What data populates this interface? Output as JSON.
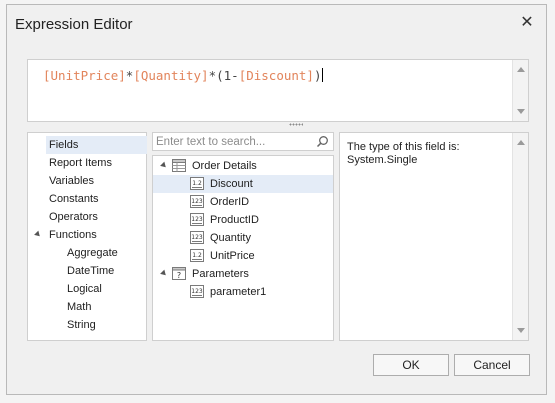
{
  "dialog": {
    "title": "Expression Editor"
  },
  "expression": {
    "tokens": [
      {
        "type": "field",
        "text": "[UnitPrice]"
      },
      {
        "type": "op",
        "text": "*"
      },
      {
        "type": "field",
        "text": "[Quantity]"
      },
      {
        "type": "op",
        "text": "*(1-"
      },
      {
        "type": "field",
        "text": "[Discount]"
      },
      {
        "type": "op",
        "text": ")"
      }
    ]
  },
  "categories": {
    "items": [
      "Fields",
      "Report Items",
      "Variables",
      "Constants",
      "Operators",
      "Functions"
    ],
    "functions": [
      "Aggregate",
      "DateTime",
      "Logical",
      "Math",
      "String"
    ],
    "selected": "Fields"
  },
  "search": {
    "placeholder": "Enter text to search..."
  },
  "tree": {
    "order_details": {
      "label": "Order Details",
      "fields": [
        {
          "label": "Discount",
          "type": "1.2"
        },
        {
          "label": "OrderID",
          "type": "123"
        },
        {
          "label": "ProductID",
          "type": "123"
        },
        {
          "label": "Quantity",
          "type": "123"
        },
        {
          "label": "UnitPrice",
          "type": "1.2"
        }
      ]
    },
    "parameters": {
      "label": "Parameters",
      "items": [
        {
          "label": "parameter1",
          "type": "123"
        }
      ]
    },
    "selected": "Discount"
  },
  "description": {
    "line1": "The type of this field is:",
    "line2": "System.Single"
  },
  "buttons": {
    "ok": "OK",
    "cancel": "Cancel"
  },
  "colors": {
    "field_token": "#e2845b",
    "selection": "#e4ecf7"
  }
}
